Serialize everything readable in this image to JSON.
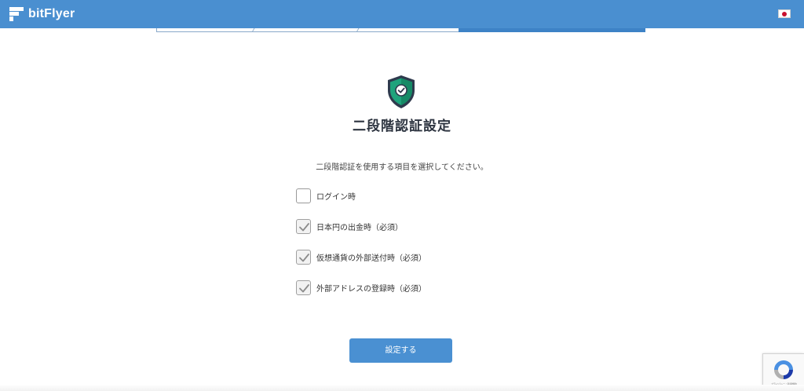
{
  "header": {
    "brand": "bitFlyer",
    "logo_icon": "bitflyer-logo-icon",
    "language_icon": "japan-flag-icon",
    "color": "#4a8fd0"
  },
  "progress": {
    "accent": "#3d82c6"
  },
  "page": {
    "icon": "shield-check-icon",
    "title": "二段階認証設定",
    "description": "二段階認証を使用する項目を選択してください。"
  },
  "options": [
    {
      "label": "ログイン時",
      "checked": false
    },
    {
      "label": "日本円の出金時（必須）",
      "checked": true
    },
    {
      "label": "仮想通貨の外部送付時（必須）",
      "checked": true
    },
    {
      "label": "外部アドレスの登録時（必須）",
      "checked": true
    }
  ],
  "actions": {
    "submit_label": "設定する",
    "submit_color": "#4a90d2"
  },
  "recaptcha": {
    "icon": "recaptcha-icon",
    "text": "プライバシー・利用規約"
  }
}
